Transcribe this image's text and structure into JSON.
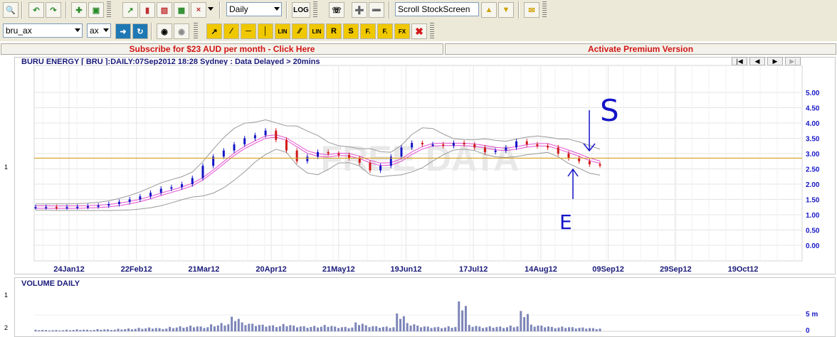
{
  "toolbar1": {
    "interval_value": "Daily",
    "scroll_value": "Scroll StockScreen",
    "log_label": "LOG"
  },
  "toolbar2": {
    "symbol_value": "bru_ax",
    "exchange_value": "ax",
    "draw_tools": [
      "LIN",
      "LIN",
      "R",
      "S",
      "F.",
      "F.",
      "FX"
    ]
  },
  "banners": {
    "subscribe": "Subscribe for $23 AUD per month - Click Here",
    "activate": "Activate Premium Version"
  },
  "chart": {
    "title": "BURU ENERGY [ BRU ]:DAILY:07Sep2012 18:28 Sydney : Data Delayed > 20mins",
    "watermark": "FREE DATA",
    "panel_label_price": "1",
    "volume_title": "VOLUME DAILY",
    "volume_panel_labels": [
      "1",
      "2"
    ],
    "volume_ticks": [
      "5 m",
      "0"
    ],
    "annotations": {
      "sell": "S",
      "enter": "E"
    },
    "colors": {
      "up": "#1515c8",
      "down": "#d01818",
      "ma": "#e34fd1",
      "band": "#9a9a9a",
      "hline": "#d4a020"
    }
  },
  "chart_data": {
    "type": "line",
    "title": "BURU ENERGY [ BRU ]:DAILY:07Sep2012 18:28 Sydney : Data Delayed > 20mins",
    "ylim": [
      0,
      5.0
    ],
    "y_ticks": [
      "5.00",
      "4.50",
      "4.00",
      "3.50",
      "3.00",
      "2.50",
      "2.00",
      "1.50",
      "1.00",
      "0.50",
      "0.00"
    ],
    "x_ticks": [
      "24Jan12",
      "22Feb12",
      "21Mar12",
      "20Apr12",
      "21May12",
      "19Jun12",
      "17Jul12",
      "14Aug12",
      "09Sep12",
      "29Sep12",
      "19Oct12"
    ],
    "horizontal_line": 2.85,
    "series": [
      {
        "values": [
          1.25,
          1.25,
          1.24,
          1.25,
          1.26,
          1.28,
          1.3,
          1.35,
          1.42,
          1.5,
          1.6,
          1.72,
          1.85,
          1.9,
          2.0,
          2.2,
          2.6,
          2.9,
          3.1,
          3.3,
          3.5,
          3.6,
          3.75,
          3.45,
          3.1,
          2.75,
          2.9,
          3.05,
          3.0,
          2.95,
          2.85,
          2.7,
          2.45,
          2.6,
          2.9,
          3.2,
          3.35,
          3.3,
          3.3,
          3.25,
          3.35,
          3.3,
          3.2,
          3.05,
          3.1,
          3.2,
          3.4,
          3.3,
          3.25,
          3.2,
          3.0,
          2.85,
          2.75,
          2.65,
          2.62
        ]
      }
    ],
    "volume": [
      0.5,
      0.4,
      0.4,
      0.5,
      0.6,
      0.5,
      0.7,
      0.6,
      0.8,
      0.9,
      1.1,
      1.2,
      1.0,
      1.4,
      1.6,
      1.8,
      1.5,
      2.2,
      2.6,
      4.6,
      2.8,
      2.4,
      2.1,
      1.9,
      2.3,
      1.8,
      1.6,
      1.7,
      2.0,
      1.5,
      1.4,
      2.8,
      1.9,
      1.6,
      1.5,
      5.6,
      2.6,
      1.8,
      1.5,
      1.4,
      1.6,
      9.4,
      2.0,
      1.5,
      1.6,
      1.5,
      1.8,
      6.4,
      2.1,
      1.8,
      1.4,
      1.5,
      1.3,
      1.2,
      1.0
    ]
  }
}
